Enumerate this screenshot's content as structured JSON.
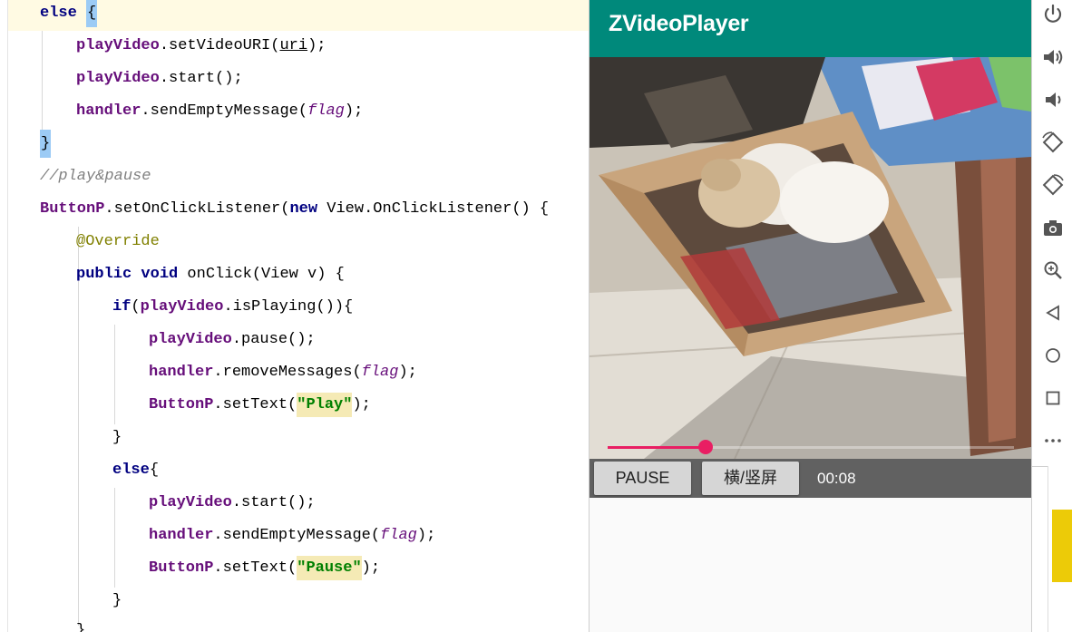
{
  "editor": {
    "lines": [
      {
        "text_else": "else",
        "brace": "{"
      },
      {
        "obj": "playVideo",
        "call": ".setVideoURI(",
        "arg": "uri",
        "end": ");"
      },
      {
        "obj": "playVideo",
        "call": ".start();"
      },
      {
        "obj": "handler",
        "call": ".sendEmptyMessage(",
        "arg": "flag",
        "end": ");"
      },
      {
        "brace": "}"
      },
      {
        "comment": "//play&pause"
      },
      {
        "obj": "ButtonP",
        "call": ".setOnClickListener(",
        "kw": "new",
        "rest": " View.OnClickListener() {"
      },
      {
        "annotation": "@Override"
      },
      {
        "kw1": "public",
        "kw2": "void",
        "rest": " onClick(View v) {"
      },
      {
        "kw": "if",
        "open": "(",
        "obj": "playVideo",
        "call": ".isPlaying()){"
      },
      {
        "obj": "playVideo",
        "call": ".pause();"
      },
      {
        "obj": "handler",
        "call": ".removeMessages(",
        "arg": "flag",
        "end": ");"
      },
      {
        "obj": "ButtonP",
        "call": ".setText(",
        "str": "\"Play\"",
        "end": ");"
      },
      {
        "brace": "}"
      },
      {
        "kw": "else",
        "brace": "{"
      },
      {
        "obj": "playVideo",
        "call": ".start();"
      },
      {
        "obj": "handler",
        "call": ".sendEmptyMessage(",
        "arg": "flag",
        "end": ");"
      },
      {
        "obj": "ButtonP",
        "call": ".setText(",
        "str": "\"Pause\"",
        "end": ");"
      },
      {
        "brace": "}"
      },
      {
        "brace": "}"
      }
    ]
  },
  "emulator": {
    "app_title": "ZVideoPlayer",
    "toolbar_color": "#00897b",
    "accent_color": "#e91e63",
    "seek_progress_fraction": 0.24,
    "pause_button_label": "PAUSE",
    "orientation_button_label": "横/竖屏",
    "time_label": "00:08"
  },
  "side_toolbar": {
    "icons": [
      "power-icon",
      "volume-up-icon",
      "volume-down-icon",
      "rotate-left-icon",
      "rotate-right-icon",
      "camera-icon",
      "zoom-icon",
      "back-icon",
      "home-icon",
      "overview-icon",
      "more-icon"
    ]
  }
}
